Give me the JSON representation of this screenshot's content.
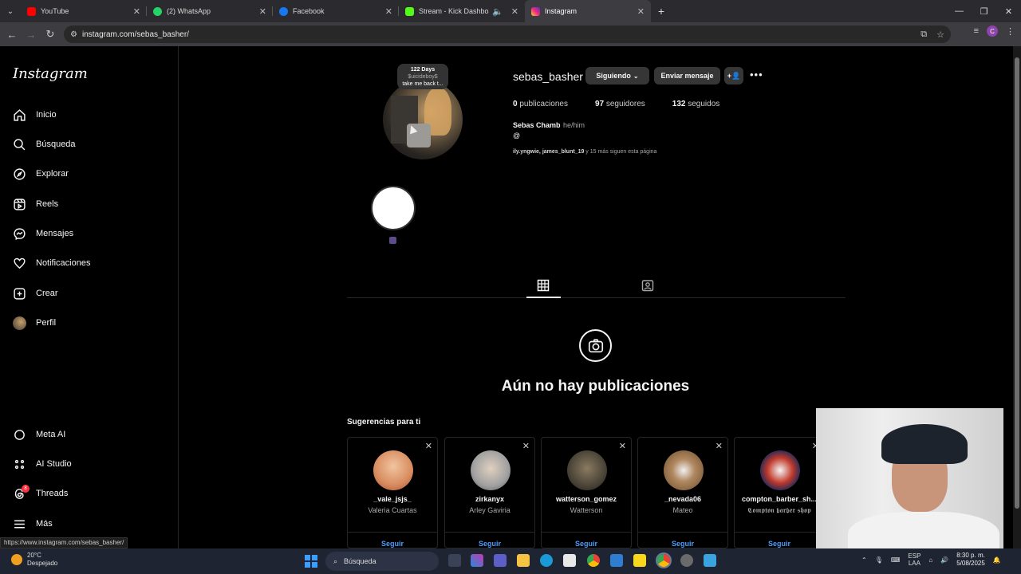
{
  "browser": {
    "tabs": [
      {
        "title": "YouTube",
        "color": "#ff0000"
      },
      {
        "title": "(2) WhatsApp",
        "color": "#25d366"
      },
      {
        "title": "Facebook",
        "color": "#1877f2"
      },
      {
        "title": "Stream - Kick Dashboard",
        "color": "#53fc18"
      },
      {
        "title": "Instagram",
        "color": "#e1306c"
      }
    ],
    "url": "instagram.com/sebas_basher/",
    "status_url": "https://www.instagram.com/sebas_basher/",
    "profile_initial": "C"
  },
  "sidebar": {
    "logo": "Instagram",
    "items": [
      {
        "label": "Inicio",
        "icon": "home-icon"
      },
      {
        "label": "Búsqueda",
        "icon": "search-icon"
      },
      {
        "label": "Explorar",
        "icon": "compass-icon"
      },
      {
        "label": "Reels",
        "icon": "reels-icon"
      },
      {
        "label": "Mensajes",
        "icon": "messenger-icon"
      },
      {
        "label": "Notificaciones",
        "icon": "heart-icon"
      },
      {
        "label": "Crear",
        "icon": "plus-square-icon"
      },
      {
        "label": "Perfil",
        "icon": "avatar-icon"
      }
    ],
    "bottom_items": [
      {
        "label": "Meta AI",
        "icon": "meta-ai-icon"
      },
      {
        "label": "AI Studio",
        "icon": "ai-studio-icon"
      },
      {
        "label": "Threads",
        "icon": "threads-icon",
        "badge": "8"
      },
      {
        "label": "Más",
        "icon": "menu-icon"
      }
    ]
  },
  "profile": {
    "username": "sebas_basher",
    "following_label": "Siguiendo",
    "message_label": "Enviar mensaje",
    "posts_count": "0",
    "posts_label": "publicaciones",
    "followers_count": "97",
    "followers_label": "seguidores",
    "following_count": "132",
    "following_count_label": "seguidos",
    "full_name": "Sebas Chamb",
    "pronouns": "he/him",
    "threads_glyph": "@",
    "followed_by_names": "ily.yngwie, james_blunt_19",
    "followed_by_rest": " y 15 más siguen esta página",
    "note": {
      "line1": "122 Days",
      "line2": "$uicideboy$",
      "line3": "take me back t..."
    }
  },
  "content": {
    "empty_title": "Aún no hay publicaciones",
    "suggestions_title": "Sugerencias para ti",
    "suggestions": [
      {
        "username": "_vale_jsjs_",
        "name": "Valeria Cuartas",
        "follow": "Seguir",
        "avatar_color": "#d88b5f"
      },
      {
        "username": "zirkanyx",
        "name": "Arley Gaviria",
        "follow": "Seguir",
        "avatar_color": "#a0a0a0"
      },
      {
        "username": "watterson_gomez",
        "name": "Watterson",
        "follow": "Seguir",
        "avatar_color": "#4a4438"
      },
      {
        "username": "_nevada06",
        "name": "Mateo",
        "follow": "Seguir",
        "avatar_color": "#8a6a4a"
      },
      {
        "username": "compton_barber_sh...",
        "name": "𝕮𝖔𝖒𝖕𝖙𝖔𝖓 𝖇𝖆𝖗𝖇𝖊𝖗 𝖘𝖍𝖔𝖕",
        "follow": "Seguir",
        "avatar_color": "#c0392b"
      }
    ]
  },
  "taskbar": {
    "weather_temp": "20°C",
    "weather_desc": "Despejado",
    "search_label": "Búsqueda",
    "lang": "ESP",
    "lang2": "LAA",
    "time": "8:30 p. m.",
    "date": "5/08/2025"
  }
}
